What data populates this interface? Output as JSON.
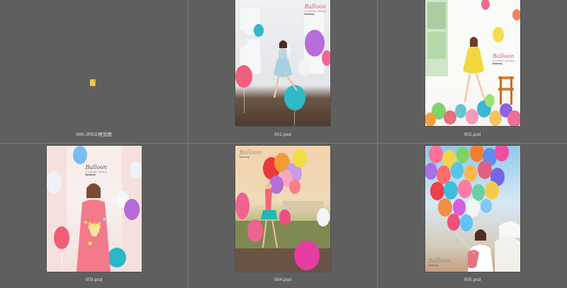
{
  "gallery": {
    "items": [
      {
        "name": "000-JPEG预览图",
        "type": "folder",
        "icon": "folder-icon"
      },
      {
        "name": "001.psd",
        "type": "image",
        "logo": {
          "main": "Balloon",
          "sub": "a romantic fantasy",
          "tag": "fantasy"
        }
      },
      {
        "name": "002.psd",
        "type": "image",
        "logo": {
          "main": "Balloon",
          "sub": "a romantic fantasy",
          "tag": "fantasy"
        }
      },
      {
        "name": "003.psd",
        "type": "image",
        "logo": {
          "main": "Balloon",
          "sub": "a romantic fantasy",
          "tag": "fantasy"
        }
      },
      {
        "name": "004.psd",
        "type": "image",
        "logo": {
          "main": "Balloon",
          "sub": "",
          "tag": "fantasy"
        }
      },
      {
        "name": "005.psd",
        "type": "image",
        "logo": {
          "main": "Balloon",
          "sub": "",
          "tag": "fantasy"
        }
      }
    ]
  },
  "colors": {
    "background": "#5f5f5f",
    "divider": "#7a7a7a",
    "caption": "#e3e3e3",
    "folder": "#f1c84b"
  }
}
